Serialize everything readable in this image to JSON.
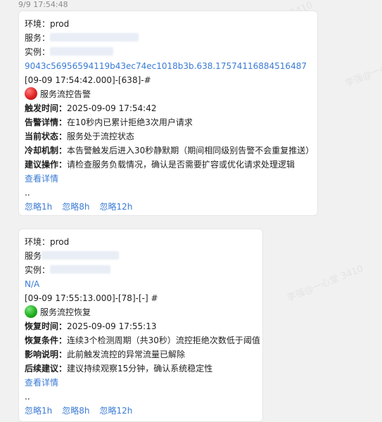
{
  "timestamp": "9/9 17:54:48",
  "watermarks": [
    "3410",
    "李强@一心堂",
    "李强@一心堂 3410"
  ],
  "card1": {
    "env": "环境：prod",
    "service_label": "服务：",
    "instance_label": "实例：",
    "instance_id": "9043c56956594119b43ec74ec1018b3b.638.17574116884516487",
    "header": "[09-09 17:54:42.000]-[638]-#",
    "title": "服务流控告警",
    "rows": [
      {
        "label": "触发时间：",
        "value": "2025-09-09 17:54:42"
      },
      {
        "label": "告警详情：",
        "value": "在10秒内已累计拒绝3次用户请求"
      },
      {
        "label": "当前状态：",
        "value": "服务处于流控状态"
      },
      {
        "label": "冷却机制：",
        "value": "本告警触发后进入30秒静默期（期间相同级别告警不会重复推送）"
      },
      {
        "label": "建议操作：",
        "value": "请检查服务负载情况，确认是否需要扩容或优化请求处理逻辑"
      }
    ],
    "details_link": "查看详情",
    "ellipsis": "..",
    "actions": [
      "忽略1h",
      "忽略8h",
      "忽略12h"
    ]
  },
  "card2": {
    "env": "环境：prod",
    "service_label": "服务",
    "instance_label": "实例：",
    "instance_id": "N/A",
    "header": "[09-09 17:55:13.000]-[78]-[-] #",
    "title": "服务流控恢复",
    "rows": [
      {
        "label": "恢复时间：",
        "value": "2025-09-09 17:55:13"
      },
      {
        "label": "恢复条件：",
        "value": "连续3个检测周期（共30秒）流控拒绝次数低于阈值"
      },
      {
        "label": "影响说明：",
        "value": "此前触发流控的异常流量已解除"
      },
      {
        "label": "后续建议：",
        "value": "建议持续观察15分钟，确认系统稳定性"
      }
    ],
    "details_link": "查看详情",
    "ellipsis": "..",
    "actions": [
      "忽略1h",
      "忽略8h",
      "忽略12h"
    ]
  },
  "colors": {
    "link": "#3a7bd5",
    "alert": "#e02525",
    "recover": "#22b122"
  }
}
